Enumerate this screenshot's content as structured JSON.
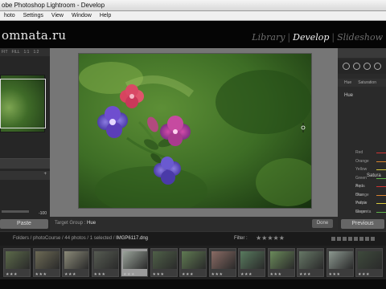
{
  "window": {
    "title": "obe Photoshop Lightroom - Develop"
  },
  "menu": [
    "hoto",
    "Settings",
    "View",
    "Window",
    "Help"
  ],
  "brand": "omnata.ru",
  "modules": [
    {
      "label": "Library",
      "active": false
    },
    {
      "label": "Develop",
      "active": true
    },
    {
      "label": "Slideshow",
      "active": false
    }
  ],
  "module_separator": "|",
  "navigator": {
    "zoom_options": [
      "FIT",
      "FILL",
      "1:1",
      "1:2"
    ]
  },
  "left_panel": {
    "add_symbol": "+",
    "slider_value": "-100",
    "paste_label": "Paste"
  },
  "center": {
    "target_group_label": "Target Group :",
    "target_group_value": "Hue",
    "done_label": "Done"
  },
  "right_panel": {
    "tabs": [
      "Hue",
      "Saturation"
    ],
    "hue_section": "Hue",
    "hue_colors": [
      "Red",
      "Orange",
      "Yellow",
      "Green",
      "Aqua",
      "Blue",
      "Purple",
      "Magenta"
    ],
    "saturation_section": "Satura",
    "saturation_colors": [
      "Red",
      "Orange",
      "Yellow",
      "Green"
    ],
    "previous_label": "Previous"
  },
  "filmstrip_bar": {
    "path": "Folders / photoCourse / 44 photos / 1 selected / ",
    "file": "IMGP6117.dng",
    "filter_label": "Filter :",
    "stars": "★★★★★"
  },
  "filmstrip": {
    "thumbnails": [
      {
        "rating": "★★★"
      },
      {
        "rating": "★★★"
      },
      {
        "rating": "★★★"
      },
      {
        "rating": "★★★"
      },
      {
        "rating": "★★★",
        "selected": true
      },
      {
        "rating": "★★★"
      },
      {
        "rating": "★★★"
      },
      {
        "rating": "★★★"
      },
      {
        "rating": "★★★"
      },
      {
        "rating": "★★★"
      },
      {
        "rating": "★★★"
      },
      {
        "rating": "★★★"
      },
      {
        "rating": "★★★"
      }
    ]
  },
  "colors": {
    "hue_bars": [
      "#c33",
      "#d7822f",
      "#d8c93d",
      "#5fb34a",
      "#3fb7b0",
      "#3e62c8",
      "#7b4ab5",
      "#c43fa8"
    ]
  }
}
